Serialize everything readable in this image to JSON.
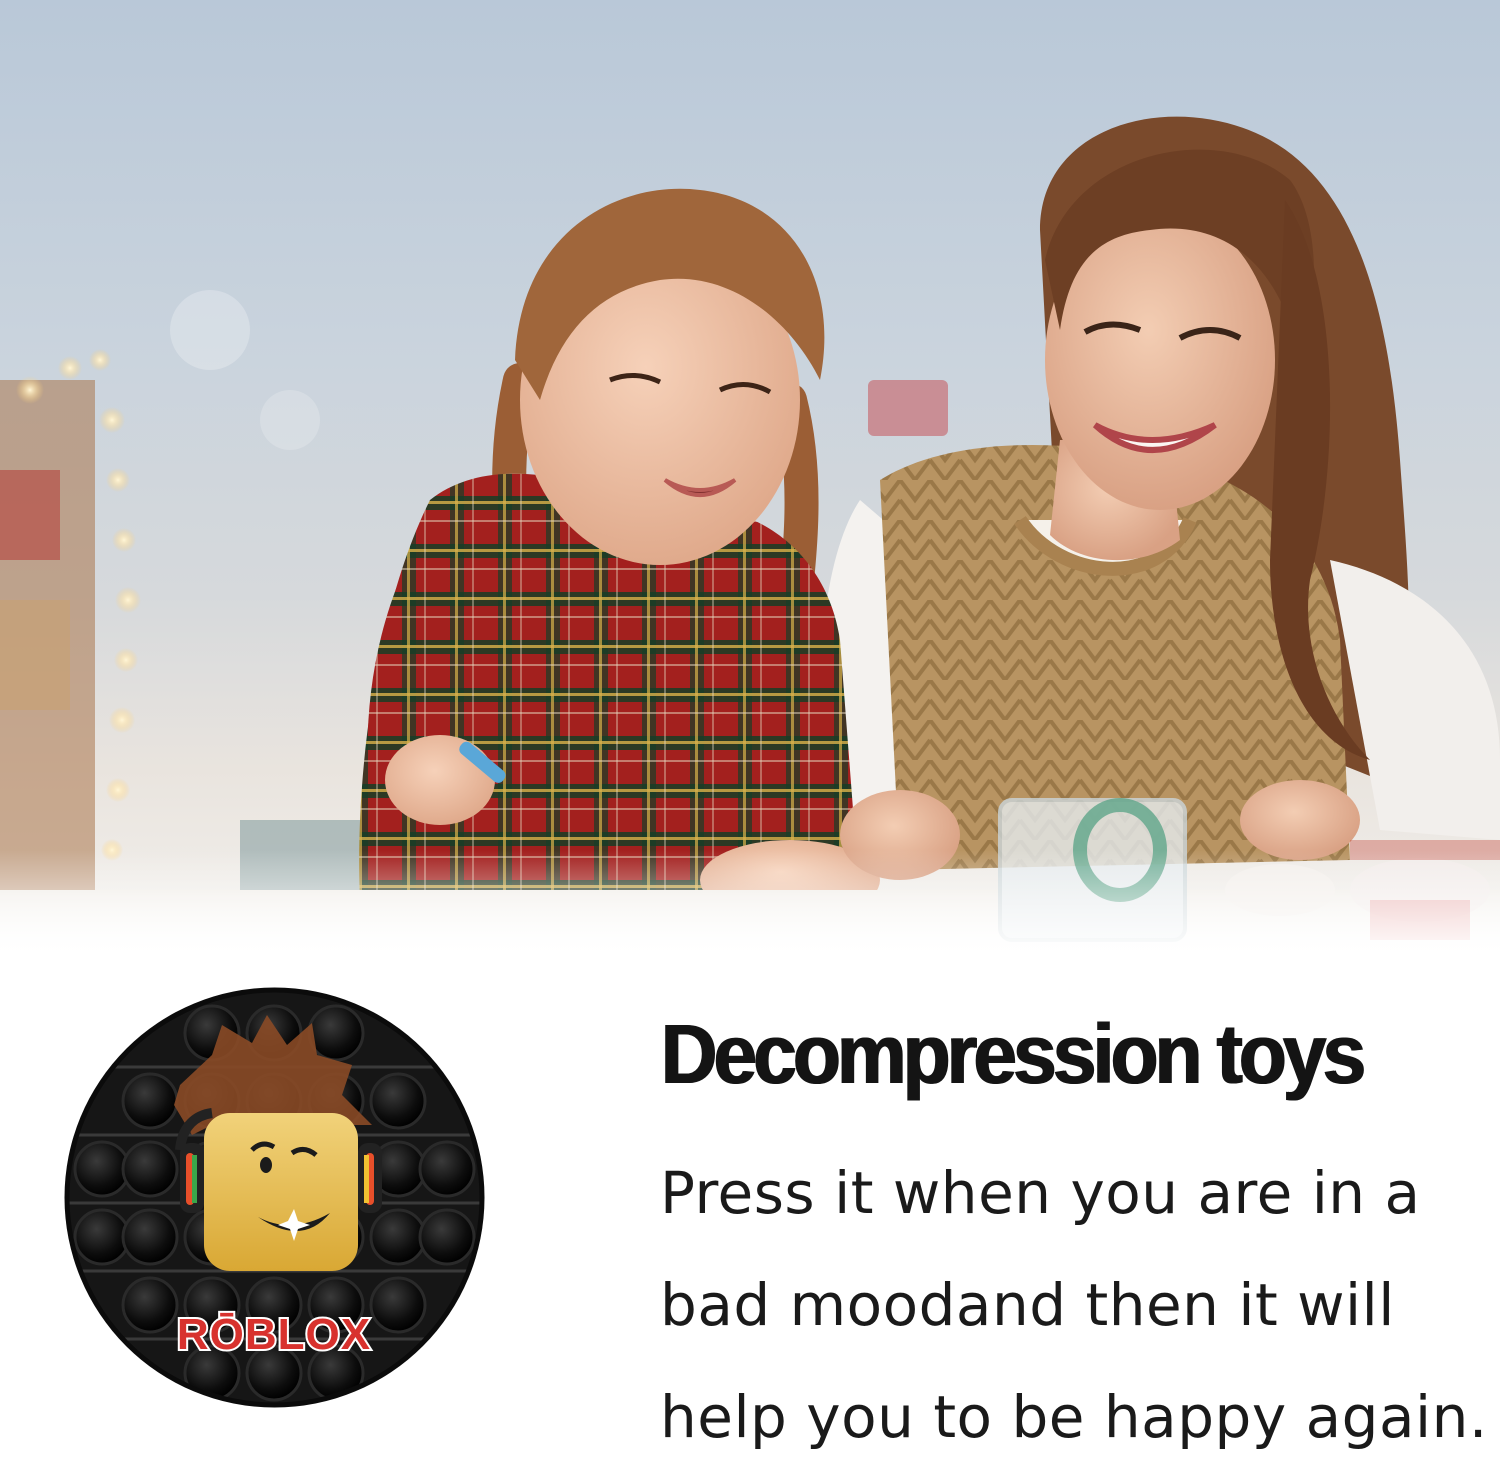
{
  "photo": {
    "subject": "girl-and-woman-crafting-photo"
  },
  "toy": {
    "logo_text": "RŌBLOX",
    "color_body": "#141414",
    "color_logo": "#d8322e"
  },
  "headline": "Decompression toys",
  "body": "Press it when you are in a bad moodand then it will help you to be happy again."
}
